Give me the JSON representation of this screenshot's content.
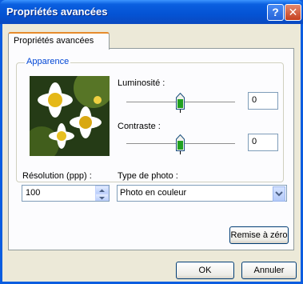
{
  "window": {
    "title": "Propriétés avancées"
  },
  "tabs": [
    {
      "label": "Propriétés avancées"
    }
  ],
  "appearance": {
    "group_label": "Apparence",
    "brightness": {
      "label": "Luminosité :",
      "value": "0",
      "level": 0.5
    },
    "contrast": {
      "label": "Contraste :",
      "value": "0",
      "level": 0.5
    }
  },
  "resolution": {
    "label": "Résolution (ppp) :",
    "value": "100"
  },
  "photo_type": {
    "label": "Type de photo :",
    "selected": "Photo en couleur"
  },
  "buttons": {
    "reset": "Remise à zéro",
    "ok": "OK",
    "cancel": "Annuler"
  },
  "icons": {
    "help": "help-icon",
    "close": "close-icon"
  }
}
